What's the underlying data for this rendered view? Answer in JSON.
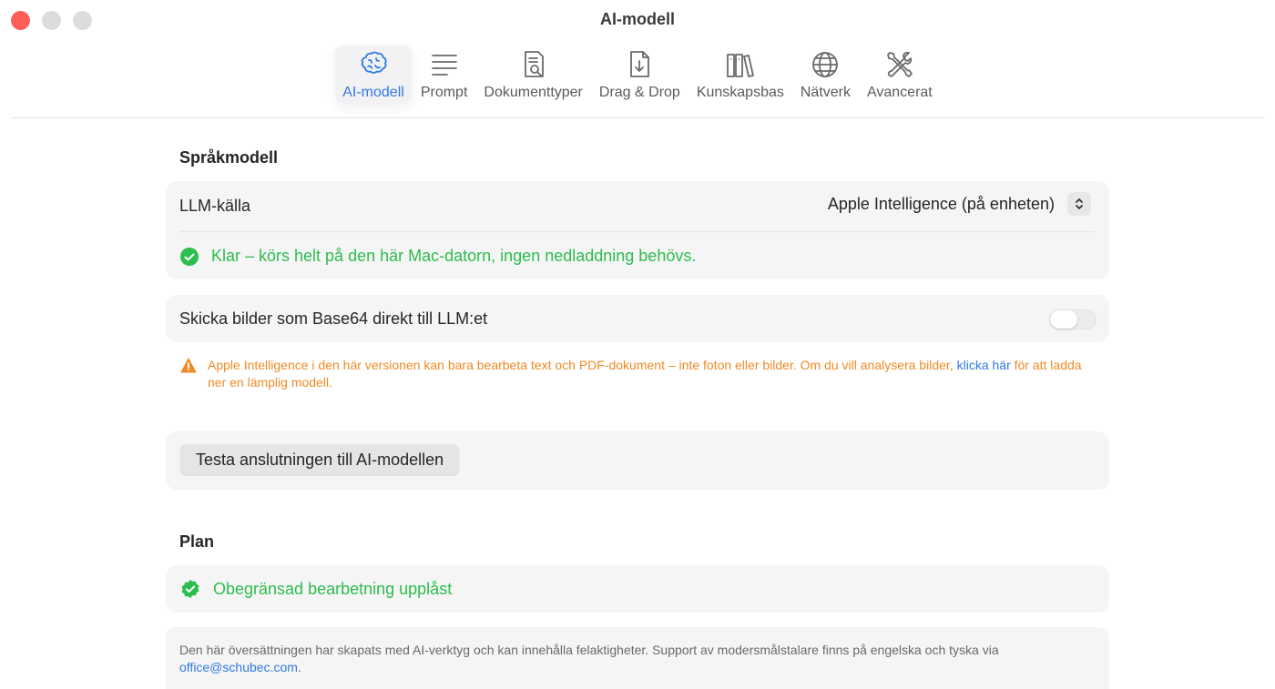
{
  "window": {
    "title": "AI-modell"
  },
  "toolbar": {
    "tabs": [
      {
        "label": "AI-modell",
        "icon": "brain-icon",
        "active": true
      },
      {
        "label": "Prompt",
        "icon": "text-lines-icon",
        "active": false
      },
      {
        "label": "Dokumenttyper",
        "icon": "document-search-icon",
        "active": false
      },
      {
        "label": "Drag & Drop",
        "icon": "document-download-icon",
        "active": false
      },
      {
        "label": "Kunskapsbas",
        "icon": "books-icon",
        "active": false
      },
      {
        "label": "Nätverk",
        "icon": "globe-icon",
        "active": false
      },
      {
        "label": "Avancerat",
        "icon": "tools-icon",
        "active": false
      }
    ]
  },
  "language_model": {
    "section_title": "Språkmodell",
    "llm_source_label": "LLM-källa",
    "llm_source_value": "Apple Intelligence (på enheten)",
    "status_text": "Klar – körs helt på den här Mac-datorn, ingen nedladdning behövs.",
    "base64_label": "Skicka bilder som Base64 direkt till LLM:et",
    "base64_enabled": false,
    "warning_text_before": "Apple Intelligence i den här versionen kan bara bearbeta text och PDF-dokument – inte foton eller bilder. Om du vill analysera bilder,",
    "warning_link": "klicka här",
    "warning_text_after": "för att ladda ner en lämplig modell.",
    "test_button": "Testa anslutningen till AI-modellen"
  },
  "plan": {
    "section_title": "Plan",
    "status_text": "Obegränsad bearbetning upplåst"
  },
  "footer": {
    "text": "Den här översättningen har skapats med AI-verktyg och kan innehålla felaktigheter. Support av modersmålstalare finns på engelska och tyska via",
    "email": "office@schubec.com",
    "period": "."
  },
  "colors": {
    "accent": "#2f7ae5",
    "success": "#2dbd4e",
    "warning": "#f08a24",
    "close": "#fe5f57"
  }
}
